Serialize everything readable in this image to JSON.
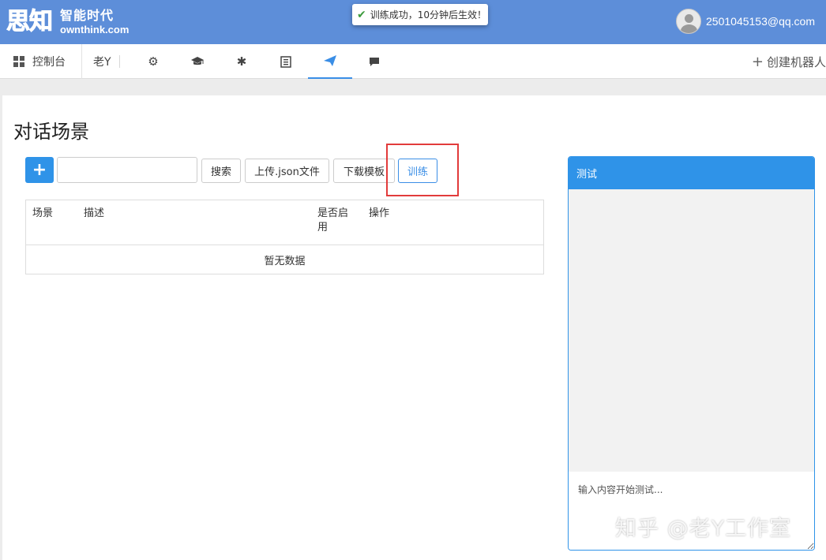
{
  "header": {
    "logo_main": "思知",
    "logo_cn": "智能时代",
    "logo_en": "ownthink.com",
    "toast": "训练成功，10分钟后生效！",
    "user_email": "2501045153@qq.com"
  },
  "nav": {
    "dashboard": "控制台",
    "bot_name": "老Y",
    "icons": [
      "gear-icon",
      "graduation-cap-icon",
      "asterisk-icon",
      "book-icon",
      "paper-plane-icon",
      "comment-icon"
    ],
    "active_icon": "paper-plane-icon",
    "create": "创建机器人"
  },
  "main": {
    "title": "对话场景",
    "search_placeholder": "",
    "buttons": {
      "add": "+",
      "search": "搜索",
      "upload": "上传.json文件",
      "download": "下载模板",
      "train": "训练"
    },
    "table": {
      "columns": [
        "场景",
        "描述",
        "是否启用",
        "操作"
      ],
      "empty": "暂无数据"
    }
  },
  "test_panel": {
    "title": "测试",
    "input_placeholder": "输入内容开始测试..."
  },
  "watermark": "知乎 @老Y工作室",
  "colors": {
    "header_bg": "#5d8ed9",
    "primary": "#2f93e8",
    "highlight": "#e23b3b"
  }
}
